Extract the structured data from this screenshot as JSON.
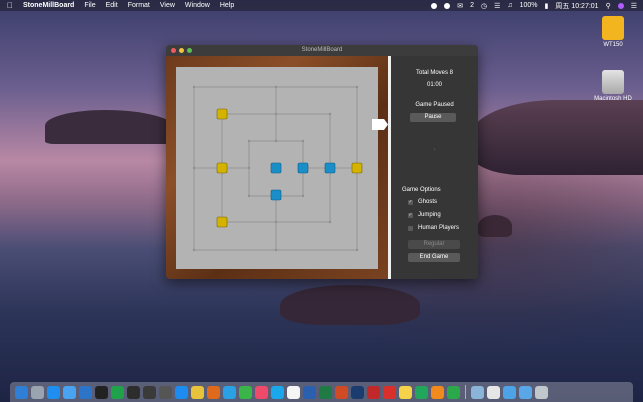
{
  "menubar": {
    "app_name": "StoneMillBoard",
    "items": [
      "File",
      "Edit",
      "Format",
      "View",
      "Window",
      "Help"
    ],
    "notification_count": "2",
    "battery": "100%",
    "clock": "周五 10:27:01"
  },
  "desktop_icons": [
    {
      "label": "WT150",
      "icon": "drive-icon",
      "color": "#f2b51f"
    },
    {
      "label": "Macintosh HD",
      "icon": "hard-disk-icon",
      "color": "#c8c8c8"
    }
  ],
  "window": {
    "title": "StoneMillBoard"
  },
  "panel": {
    "total_moves": "Total Moves 8",
    "timer": "01:00",
    "status": "Game Paused",
    "pause_label": "Pause",
    "options_heading": "Game Options",
    "options": [
      {
        "label": "Ghosts",
        "checked": true
      },
      {
        "label": "Jumping",
        "checked": true
      },
      {
        "label": "Human Players",
        "checked": false
      }
    ],
    "regular_label": "Regular",
    "end_game_label": "End Game"
  },
  "colors": {
    "yellow_piece": "#d4b300",
    "blue_piece": "#1a8fc7",
    "board": "#b3b3b3",
    "frame_wood": "#7a4321"
  },
  "dock_items": [
    "finder-icon",
    "launchpad-icon",
    "safari-icon",
    "mail-icon",
    "vscode-icon",
    "terminal-icon",
    "spreadsheet-icon",
    "console-icon",
    "activity-icon",
    "screen-icon",
    "appstore-icon",
    "chrome-icon",
    "firefox-icon",
    "qq-icon",
    "wechat-icon",
    "music-icon",
    "skype-icon",
    "calendar-icon",
    "word-icon",
    "excel-icon",
    "powerpoint-icon",
    "photoshop-icon",
    "filezilla-icon",
    "pdf-icon",
    "notes-icon",
    "pycharm-icon",
    "vlc-icon",
    "sync-icon",
    "preview-icon",
    "photos-icon",
    "folder-icon",
    "downloads-icon",
    "trash-icon"
  ]
}
